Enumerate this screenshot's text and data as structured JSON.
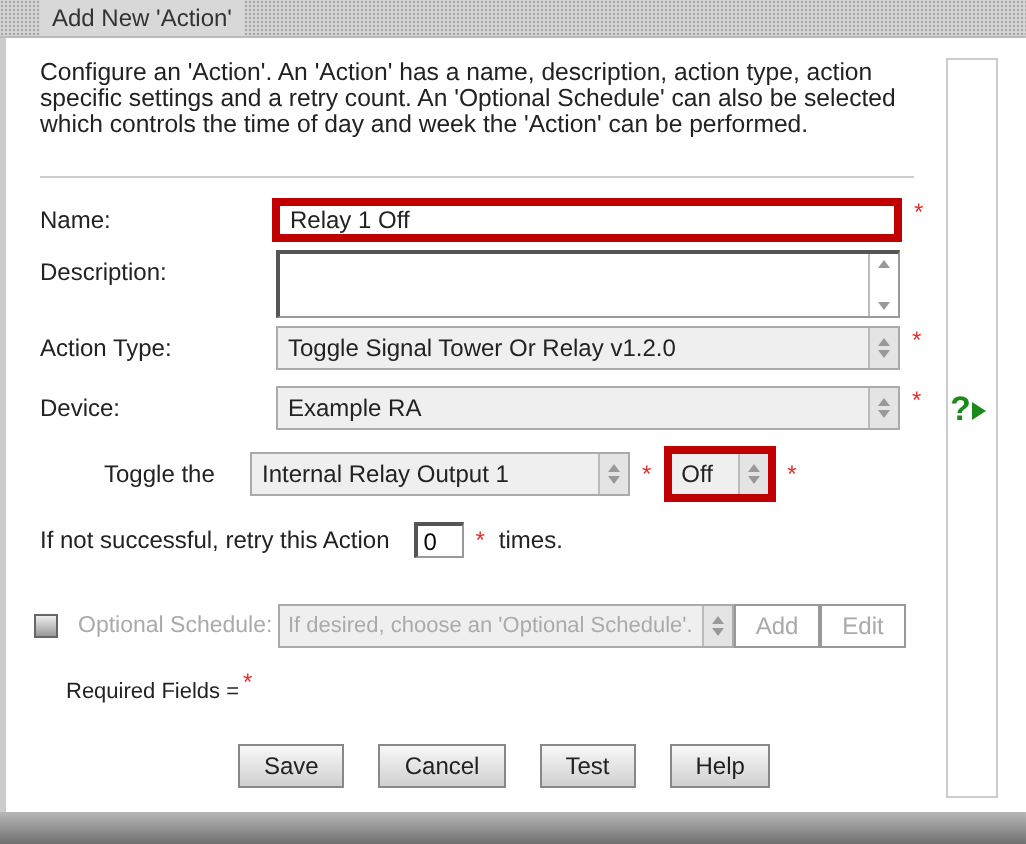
{
  "window": {
    "title": "Add New 'Action'"
  },
  "intro": "Configure an 'Action'. An 'Action' has a name, description, action type, action specific settings and a retry count. An 'Optional Schedule' can also be selected which controls the time of day and week the 'Action' can be performed.",
  "fields": [
    {
      "kind": "text",
      "label": "Name:",
      "value": "Relay 1 Off",
      "required_mark": "*",
      "highlighted": true
    },
    {
      "kind": "textarea",
      "label": "Description:",
      "highlighted": false
    },
    {
      "kind": "select",
      "label": "Action Type:",
      "value": "Toggle Signal Tower Or Relay v1.2.0",
      "required_mark": "*",
      "highlighted": false
    },
    {
      "kind": "select",
      "label": "Device:",
      "value": "Example RA",
      "required_mark": "*",
      "highlighted": false
    }
  ],
  "help_icon": "?",
  "toggle": {
    "label": "Toggle the",
    "output": {
      "value": "Internal Relay Output 1",
      "required_mark": "*",
      "highlighted": false
    },
    "state": {
      "value": "Off",
      "required_mark": "*",
      "highlighted": true
    }
  },
  "retry": {
    "label": "If not successful, retry this Action",
    "value": "0",
    "required_mark": "*",
    "suffix": "times."
  },
  "schedule": {
    "checked": false,
    "disabled": true,
    "label": "Optional Schedule:",
    "placeholder": "If desired, choose an 'Optional Schedule'.",
    "buttons": [
      "Add",
      "Edit"
    ]
  },
  "required_note": {
    "text": "Required Fields =",
    "mark": "*"
  },
  "buttons": [
    "Save",
    "Cancel",
    "Test",
    "Help"
  ]
}
